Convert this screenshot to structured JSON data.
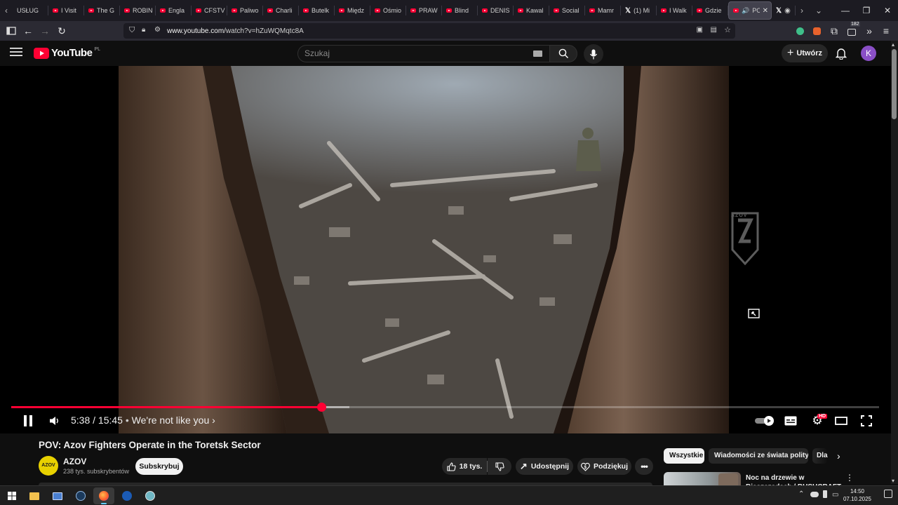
{
  "browser": {
    "tabs": [
      {
        "label": "USŁUG",
        "icon": "none"
      },
      {
        "label": "I Visit",
        "icon": "youtube"
      },
      {
        "label": "The G",
        "icon": "youtube"
      },
      {
        "label": "ROBIN",
        "icon": "youtube"
      },
      {
        "label": "Engla",
        "icon": "youtube"
      },
      {
        "label": "CFSTV",
        "icon": "youtube"
      },
      {
        "label": "Paliwo",
        "icon": "youtube"
      },
      {
        "label": "Charli",
        "icon": "youtube"
      },
      {
        "label": "Butelk",
        "icon": "youtube"
      },
      {
        "label": "Międz",
        "icon": "youtube"
      },
      {
        "label": "Ośmio",
        "icon": "youtube"
      },
      {
        "label": "PRAW",
        "icon": "youtube"
      },
      {
        "label": "Blind",
        "icon": "youtube"
      },
      {
        "label": "DENIS",
        "icon": "youtube"
      },
      {
        "label": "Kawal",
        "icon": "youtube"
      },
      {
        "label": "Social",
        "icon": "youtube"
      },
      {
        "label": "Mamr",
        "icon": "youtube"
      },
      {
        "label": "(1) Mi",
        "icon": "x"
      },
      {
        "label": "I Walk",
        "icon": "youtube"
      },
      {
        "label": "Gdzie",
        "icon": "youtube"
      }
    ],
    "active_tab": {
      "label": "POV",
      "icon": "youtube"
    },
    "url_host": "www.youtube.com",
    "url_path": "/watch?v=hZuWQMqtc8A",
    "extensions_badge": "182"
  },
  "youtube": {
    "logo_text": "YouTube",
    "logo_region": "PL",
    "search_placeholder": "Szukaj",
    "create_label": "Utwórz",
    "avatar_letter": "K",
    "accent": "#ff0033"
  },
  "player": {
    "current_time": "5:38",
    "duration": "15:45",
    "time_separator": "/",
    "chapter": "We're not like you",
    "played_fraction": 0.358,
    "buffered_fraction": 0.39,
    "quality_badge": "HD",
    "watermark": "AZOV"
  },
  "video": {
    "title": "POV: Azov Fighters Operate in the Toretsk Sector",
    "channel_name": "AZOV",
    "channel_avatar_text": "AZOV",
    "subscribers": "238 tys. subskrybentów",
    "subscribe_label": "Subskrybuj",
    "likes": "18 tys.",
    "share_label": "Udostępnij",
    "thanks_label": "Podziękuj"
  },
  "recommendations": {
    "chips": [
      "Wszystkie",
      "Wiadomości ze świata polityki",
      "Dla"
    ],
    "first_item_title": "Noc na drzewie w Bieszczadach / BUSHCRAFT"
  },
  "taskbar": {
    "time": "14:50",
    "date": "07.10.2025"
  }
}
